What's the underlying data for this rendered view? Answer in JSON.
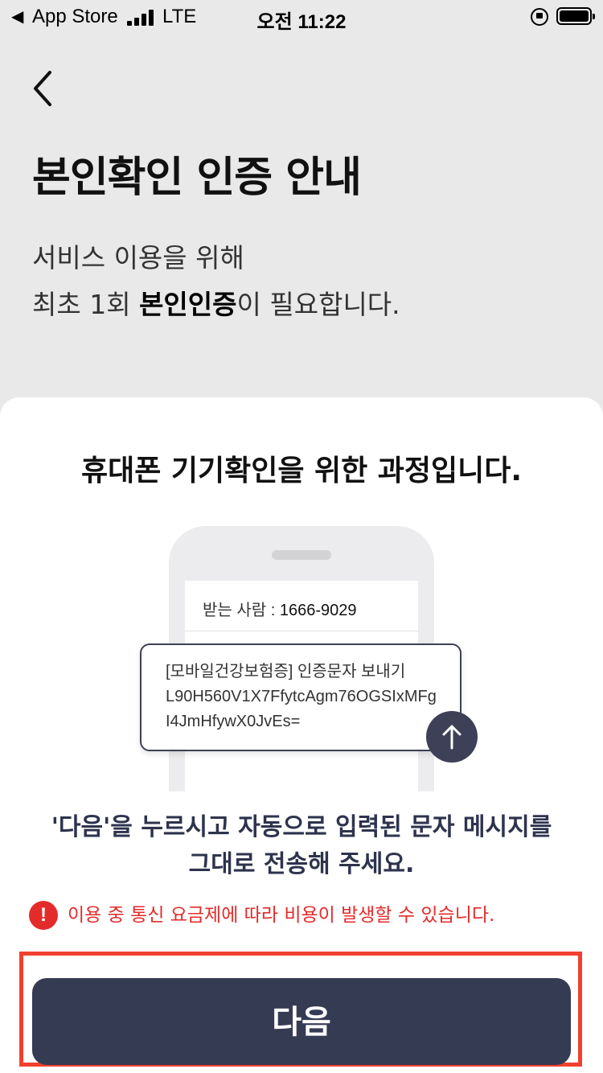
{
  "status_bar": {
    "back_glyph": "◀",
    "app_label": "App Store",
    "network": "LTE",
    "time": "오전 11:22"
  },
  "page": {
    "title": "본인확인 인증 안내",
    "description_line1": "서비스 이용을 위해",
    "description_line2_prefix": "최초 1회 ",
    "description_line2_bold": "본인인증",
    "description_line2_suffix": "이 필요합니다."
  },
  "sheet": {
    "title": "휴대폰 기기확인을 위한 과정입니다.",
    "recipient_label": "받는 사람 : ",
    "recipient_number": "1666-9029",
    "message_line1": "[모바일건강보험증] 인증문자 보내기",
    "message_line2": "L90H560V1X7FfytcAgm76OGSIxMFg",
    "message_line3": "I4JmHfywX0JvEs=",
    "instruction_line1": "'다음'을 누르시고 자동으로 입력된 문자 메시지를",
    "instruction_line2": "그대로 전송해 주세요.",
    "warning_glyph": "!",
    "warning_text": "이용 중 통신 요금제에 따라 비용이 발생할 수 있습니다.",
    "next_button_label": "다음"
  },
  "colors": {
    "background": "#e9e9e9",
    "primary_button": "#363b54",
    "warning": "#e42b2b",
    "highlight": "#f1402e",
    "instruction_text": "#2e334d"
  },
  "icons": [
    "chevron-left-icon",
    "signal-icon",
    "orientation-lock-icon",
    "battery-icon",
    "arrow-up-icon",
    "exclamation-icon"
  ]
}
